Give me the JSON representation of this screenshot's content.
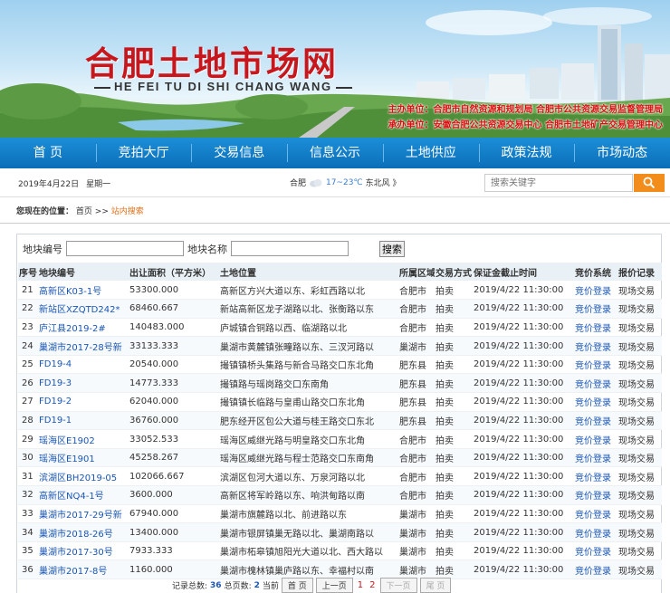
{
  "header": {
    "title": "合肥土地市场网",
    "subtitle": "HE FEI TU DI SHI CHANG WANG",
    "sponsor_line": "主办单位：合肥市自然资源和规划局 合肥市公共资源交易监督管理局",
    "organizer_line": "承办单位：安徽合肥公共资源交易中心 合肥市土地矿产交易管理中心"
  },
  "nav": {
    "items": [
      "首 页",
      "竞拍大厅",
      "交易信息",
      "信息公示",
      "土地供应",
      "政策法规",
      "市场动态"
    ]
  },
  "infobar": {
    "date": "2019年4月22日",
    "weekday": "星期一",
    "city": "合肥",
    "temp": "17~23℃",
    "wind": "东北风 》",
    "search_placeholder": "搜索关键字"
  },
  "breadcrumb": {
    "label": "您现在的位置：",
    "home": "首页",
    "sep": ">>",
    "current": "站内搜索"
  },
  "filters": {
    "code_label": "地块编号",
    "name_label": "地块名称",
    "code_value": "",
    "name_value": "",
    "query_button": "搜索"
  },
  "table": {
    "headers": [
      "序号",
      "地块编号",
      "出让面积（平方米）",
      "土地位置",
      "所属区域",
      "交易方式",
      "保证金截止时间",
      "竞价系统",
      "报价记录"
    ],
    "rows": [
      {
        "no": "21",
        "code": "高新区K03-1号",
        "area": "53300.000",
        "location": "高新区方兴大道以东、彩虹西路以北",
        "region": "合肥市",
        "method": "拍卖",
        "deadline": "2019/4/22 11:30:00",
        "bid": "竞价登录",
        "record": "现场交易"
      },
      {
        "no": "22",
        "code": "新站区XZQTD242*",
        "area": "68460.667",
        "location": "新站高新区龙子湖路以北、张衡路以东",
        "region": "合肥市",
        "method": "拍卖",
        "deadline": "2019/4/22 11:30:00",
        "bid": "竞价登录",
        "record": "现场交易"
      },
      {
        "no": "23",
        "code": "庐江县2019-2#",
        "area": "140483.000",
        "location": "庐城镇合铜路以西、临湖路以北",
        "region": "合肥市",
        "method": "拍卖",
        "deadline": "2019/4/22 11:30:00",
        "bid": "竞价登录",
        "record": "现场交易"
      },
      {
        "no": "24",
        "code": "巢湖市2017-28号新",
        "area": "33133.333",
        "location": "巢湖市黄麓镇张疃路以东、三汊河路以",
        "region": "巢湖市",
        "method": "拍卖",
        "deadline": "2019/4/22 11:30:00",
        "bid": "竞价登录",
        "record": "现场交易"
      },
      {
        "no": "25",
        "code": "FD19-4",
        "area": "20540.000",
        "location": "撮镇镇桥头集路与新合马路交口东北角",
        "region": "肥东县",
        "method": "拍卖",
        "deadline": "2019/4/22 11:30:00",
        "bid": "竞价登录",
        "record": "现场交易"
      },
      {
        "no": "26",
        "code": "FD19-3",
        "area": "14773.333",
        "location": "撮镇路与瑶岗路交口东南角",
        "region": "肥东县",
        "method": "拍卖",
        "deadline": "2019/4/22 11:30:00",
        "bid": "竞价登录",
        "record": "现场交易"
      },
      {
        "no": "27",
        "code": "FD19-2",
        "area": "62040.000",
        "location": "撮镇镇长临路与皇甫山路交口东北角",
        "region": "肥东县",
        "method": "拍卖",
        "deadline": "2019/4/22 11:30:00",
        "bid": "竞价登录",
        "record": "现场交易"
      },
      {
        "no": "28",
        "code": "FD19-1",
        "area": "36760.000",
        "location": "肥东经开区包公大道与桂王路交口东北",
        "region": "肥东县",
        "method": "拍卖",
        "deadline": "2019/4/22 11:30:00",
        "bid": "竞价登录",
        "record": "现场交易"
      },
      {
        "no": "29",
        "code": "瑶海区E1902",
        "area": "33052.533",
        "location": "瑶海区威继光路与明皇路交口东北角",
        "region": "合肥市",
        "method": "拍卖",
        "deadline": "2019/4/22 11:30:00",
        "bid": "竞价登录",
        "record": "现场交易"
      },
      {
        "no": "30",
        "code": "瑶海区E1901",
        "area": "45258.267",
        "location": "瑶海区威继光路与程士范路交口东南角",
        "region": "合肥市",
        "method": "拍卖",
        "deadline": "2019/4/22 11:30:00",
        "bid": "竞价登录",
        "record": "现场交易"
      },
      {
        "no": "31",
        "code": "滨湖区BH2019-05",
        "area": "102066.667",
        "location": "滨湖区包河大道以东、万泉河路以北",
        "region": "合肥市",
        "method": "拍卖",
        "deadline": "2019/4/22 11:30:00",
        "bid": "竞价登录",
        "record": "现场交易"
      },
      {
        "no": "32",
        "code": "高新区NQ4-1号",
        "area": "3600.000",
        "location": "高新区将军岭路以东、响洪甸路以南",
        "region": "合肥市",
        "method": "拍卖",
        "deadline": "2019/4/22 11:30:00",
        "bid": "竞价登录",
        "record": "现场交易"
      },
      {
        "no": "33",
        "code": "巢湖市2017-29号新",
        "area": "67940.000",
        "location": "巢湖市旗麓路以北、前进路以东",
        "region": "巢湖市",
        "method": "拍卖",
        "deadline": "2019/4/22 11:30:00",
        "bid": "竞价登录",
        "record": "现场交易"
      },
      {
        "no": "34",
        "code": "巢湖市2018-26号",
        "area": "13400.000",
        "location": "巢湖市银屏镇巢无路以北、巢湖南路以",
        "region": "巢湖市",
        "method": "拍卖",
        "deadline": "2019/4/22 11:30:00",
        "bid": "竞价登录",
        "record": "现场交易"
      },
      {
        "no": "35",
        "code": "巢湖市2017-30号",
        "area": "7933.333",
        "location": "巢湖市柘皋镇旭阳光大道以北、西大路以",
        "region": "巢湖市",
        "method": "拍卖",
        "deadline": "2019/4/22 11:30:00",
        "bid": "竞价登录",
        "record": "现场交易"
      },
      {
        "no": "36",
        "code": "巢湖市2017-8号",
        "area": "1160.000",
        "location": "巢湖市槐林镇巢庐路以东、幸福村以南",
        "region": "巢湖市",
        "method": "拍卖",
        "deadline": "2019/4/22 11:30:00",
        "bid": "竞价登录",
        "record": "现场交易"
      }
    ]
  },
  "pager": {
    "total_label": "记录总数:",
    "total": "36",
    "pages_label": "总页数:",
    "pages": "2",
    "current_label": "当前",
    "first": "首 页",
    "prev": "上一页",
    "page1": "1",
    "page2": "2",
    "next": "下一页",
    "last": "尾 页"
  },
  "colors": {
    "brand_red": "#c8161d",
    "nav_blue": "#0b6fb8",
    "link_blue": "#1a56b5",
    "search_orange": "#f28c1a"
  }
}
